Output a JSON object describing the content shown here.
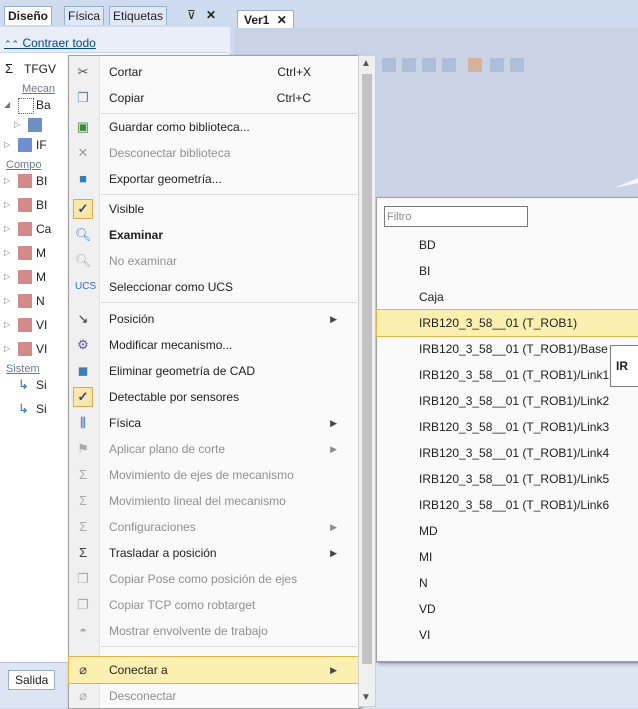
{
  "left_panel": {
    "tabs": [
      {
        "label": "Diseño"
      },
      {
        "label": "Física"
      },
      {
        "label": "Etiquetas"
      }
    ],
    "collapse_label": "Contraer todo",
    "root_label": "TFGV",
    "groups": {
      "mechanisms": "Mecan",
      "components": "Compo",
      "systems": "Sistem"
    },
    "tree": [
      {
        "label": "Ba"
      },
      {
        "label": ""
      },
      {
        "label": "IF"
      },
      {
        "label": "BI"
      },
      {
        "label": "BI"
      },
      {
        "label": "Ca"
      },
      {
        "label": "M"
      },
      {
        "label": "M"
      },
      {
        "label": "N"
      },
      {
        "label": "VI"
      },
      {
        "label": "VI"
      },
      {
        "label": "Si"
      },
      {
        "label": "Si"
      }
    ],
    "output_tab": "Salida"
  },
  "document_tab": {
    "label": "Ver1"
  },
  "context_menu": {
    "items": [
      {
        "label": "Cortar",
        "shortcut": "Ctrl+X",
        "icon": "scissors-icon"
      },
      {
        "label": "Copiar",
        "shortcut": "Ctrl+C",
        "icon": "copy-icon"
      },
      {
        "label": "Guardar como biblioteca...",
        "icon": "save-library-icon"
      },
      {
        "label": "Desconectar biblioteca",
        "icon": "disconnect-library-icon"
      },
      {
        "label": "Exportar geometría...",
        "icon": "export-geometry-icon"
      },
      {
        "label": "Visible",
        "icon": "check-icon"
      },
      {
        "label": "Examinar",
        "icon": "examine-icon"
      },
      {
        "label": "No examinar",
        "icon": "no-examine-icon"
      },
      {
        "label": "Seleccionar como UCS",
        "icon": "ucs-icon"
      },
      {
        "label": "Posición",
        "icon": "position-icon"
      },
      {
        "label": "Modificar mecanismo...",
        "icon": "modify-mechanism-icon"
      },
      {
        "label": "Eliminar geometría de CAD",
        "icon": "remove-cad-icon"
      },
      {
        "label": "Detectable por sensores",
        "icon": "check-icon"
      },
      {
        "label": "Física",
        "icon": "physics-icon"
      },
      {
        "label": "Aplicar plano de corte",
        "icon": "cut-plane-icon"
      },
      {
        "label": "Movimiento de ejes de mecanismo",
        "icon": "axis-move-icon"
      },
      {
        "label": "Movimiento lineal del mecanismo",
        "icon": "linear-move-icon"
      },
      {
        "label": "Configuraciones",
        "icon": "configurations-icon"
      },
      {
        "label": "Trasladar a posición",
        "icon": "jump-position-icon"
      },
      {
        "label": "Copiar Pose como posición de ejes",
        "icon": "copy-pose-icon"
      },
      {
        "label": "Copiar TCP como robtarget",
        "icon": "copy-tcp-icon"
      },
      {
        "label": "Mostrar envolvente de trabajo",
        "icon": "work-envelope-icon"
      },
      {
        "label": "Conectar a",
        "icon": "attach-icon"
      },
      {
        "label": "Desconectar",
        "icon": "detach-icon"
      }
    ]
  },
  "submenu": {
    "filter_placeholder": "Filtro",
    "items": [
      {
        "label": "BD"
      },
      {
        "label": "BI"
      },
      {
        "label": "Caja"
      },
      {
        "label": "IRB120_3_58__01 (T_ROB1)"
      },
      {
        "label": "IRB120_3_58__01 (T_ROB1)/Base"
      },
      {
        "label": "IRB120_3_58__01 (T_ROB1)/Link1"
      },
      {
        "label": "IRB120_3_58__01 (T_ROB1)/Link2"
      },
      {
        "label": "IRB120_3_58__01 (T_ROB1)/Link3"
      },
      {
        "label": "IRB120_3_58__01 (T_ROB1)/Link4"
      },
      {
        "label": "IRB120_3_58__01 (T_ROB1)/Link5"
      },
      {
        "label": "IRB120_3_58__01 (T_ROB1)/Link6"
      },
      {
        "label": "MD"
      },
      {
        "label": "MI"
      },
      {
        "label": "N"
      },
      {
        "label": "VD"
      },
      {
        "label": "VI"
      }
    ]
  },
  "tooltip": {
    "text": "IR"
  }
}
